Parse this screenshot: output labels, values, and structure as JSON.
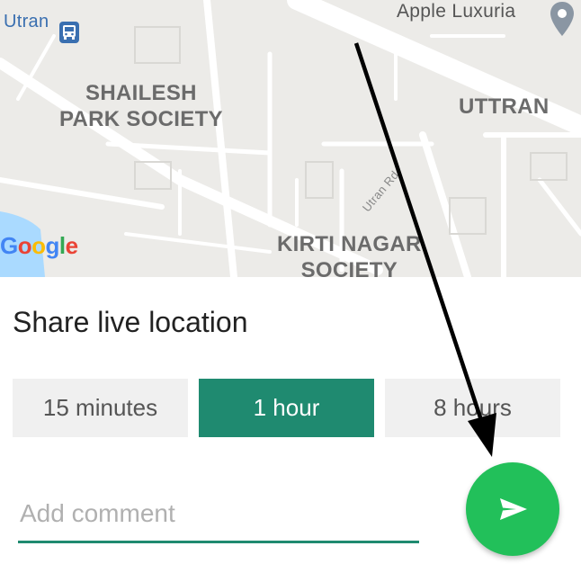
{
  "map": {
    "labels": {
      "utran_station": "Utran",
      "apple_luxuria": "Apple Luxuria",
      "shailesh_line1": "SHAILESH",
      "shailesh_line2": "PARK SOCIETY",
      "uttran": "UTTRAN",
      "kirti_line1": "KIRTI NAGAR",
      "kirti_line2": "SOCIETY",
      "road": "Utran Rd"
    },
    "attribution": "Google",
    "icons": [
      "bus-station-icon",
      "place-pin-icon"
    ]
  },
  "sheet": {
    "title": "Share live location",
    "durations": [
      {
        "label": "15 minutes",
        "selected": false
      },
      {
        "label": "1 hour",
        "selected": true
      },
      {
        "label": "8 hours",
        "selected": false
      }
    ],
    "comment_placeholder": "Add comment",
    "send_icon": "send-icon"
  },
  "colors": {
    "accent": "#1f8a70",
    "send_button": "#22c05a",
    "map_bg": "#ecebe8",
    "annotation_arrow": "#000000"
  }
}
